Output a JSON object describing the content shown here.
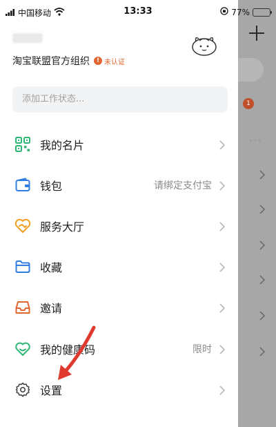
{
  "status_bar": {
    "carrier": "中国移动",
    "time": "13:33",
    "battery": "77%",
    "battery_level": 0.77,
    "icons": [
      "signal-icon",
      "wifi-icon",
      "rotation-lock-icon",
      "battery-icon"
    ]
  },
  "profile": {
    "org_name": "淘宝联盟官方组织",
    "verify_badge": "未认证",
    "badge_icon": "exclamation-icon",
    "avatar_icon": "cartoon-avatar-icon"
  },
  "status_input": {
    "placeholder": "添加工作状态..."
  },
  "menu": [
    {
      "label": "我的名片",
      "icon": "qr-code-icon",
      "extra": ""
    },
    {
      "label": "钱包",
      "icon": "wallet-icon",
      "extra": "请绑定支付宝"
    },
    {
      "label": "服务大厅",
      "icon": "handshake-heart-icon",
      "extra": ""
    },
    {
      "label": "收藏",
      "icon": "folder-icon",
      "extra": ""
    },
    {
      "label": "邀请",
      "icon": "invite-box-icon",
      "extra": ""
    },
    {
      "label": "我的健康码",
      "icon": "health-heart-icon",
      "extra": "限时"
    },
    {
      "label": "设置",
      "icon": "gear-icon",
      "extra": ""
    }
  ],
  "background_app": {
    "badge_count": "1",
    "more": "···"
  },
  "colors": {
    "green": "#2bb673",
    "blue": "#2f7de1",
    "orange": "#f0a020",
    "red_orange": "#e1652e"
  }
}
